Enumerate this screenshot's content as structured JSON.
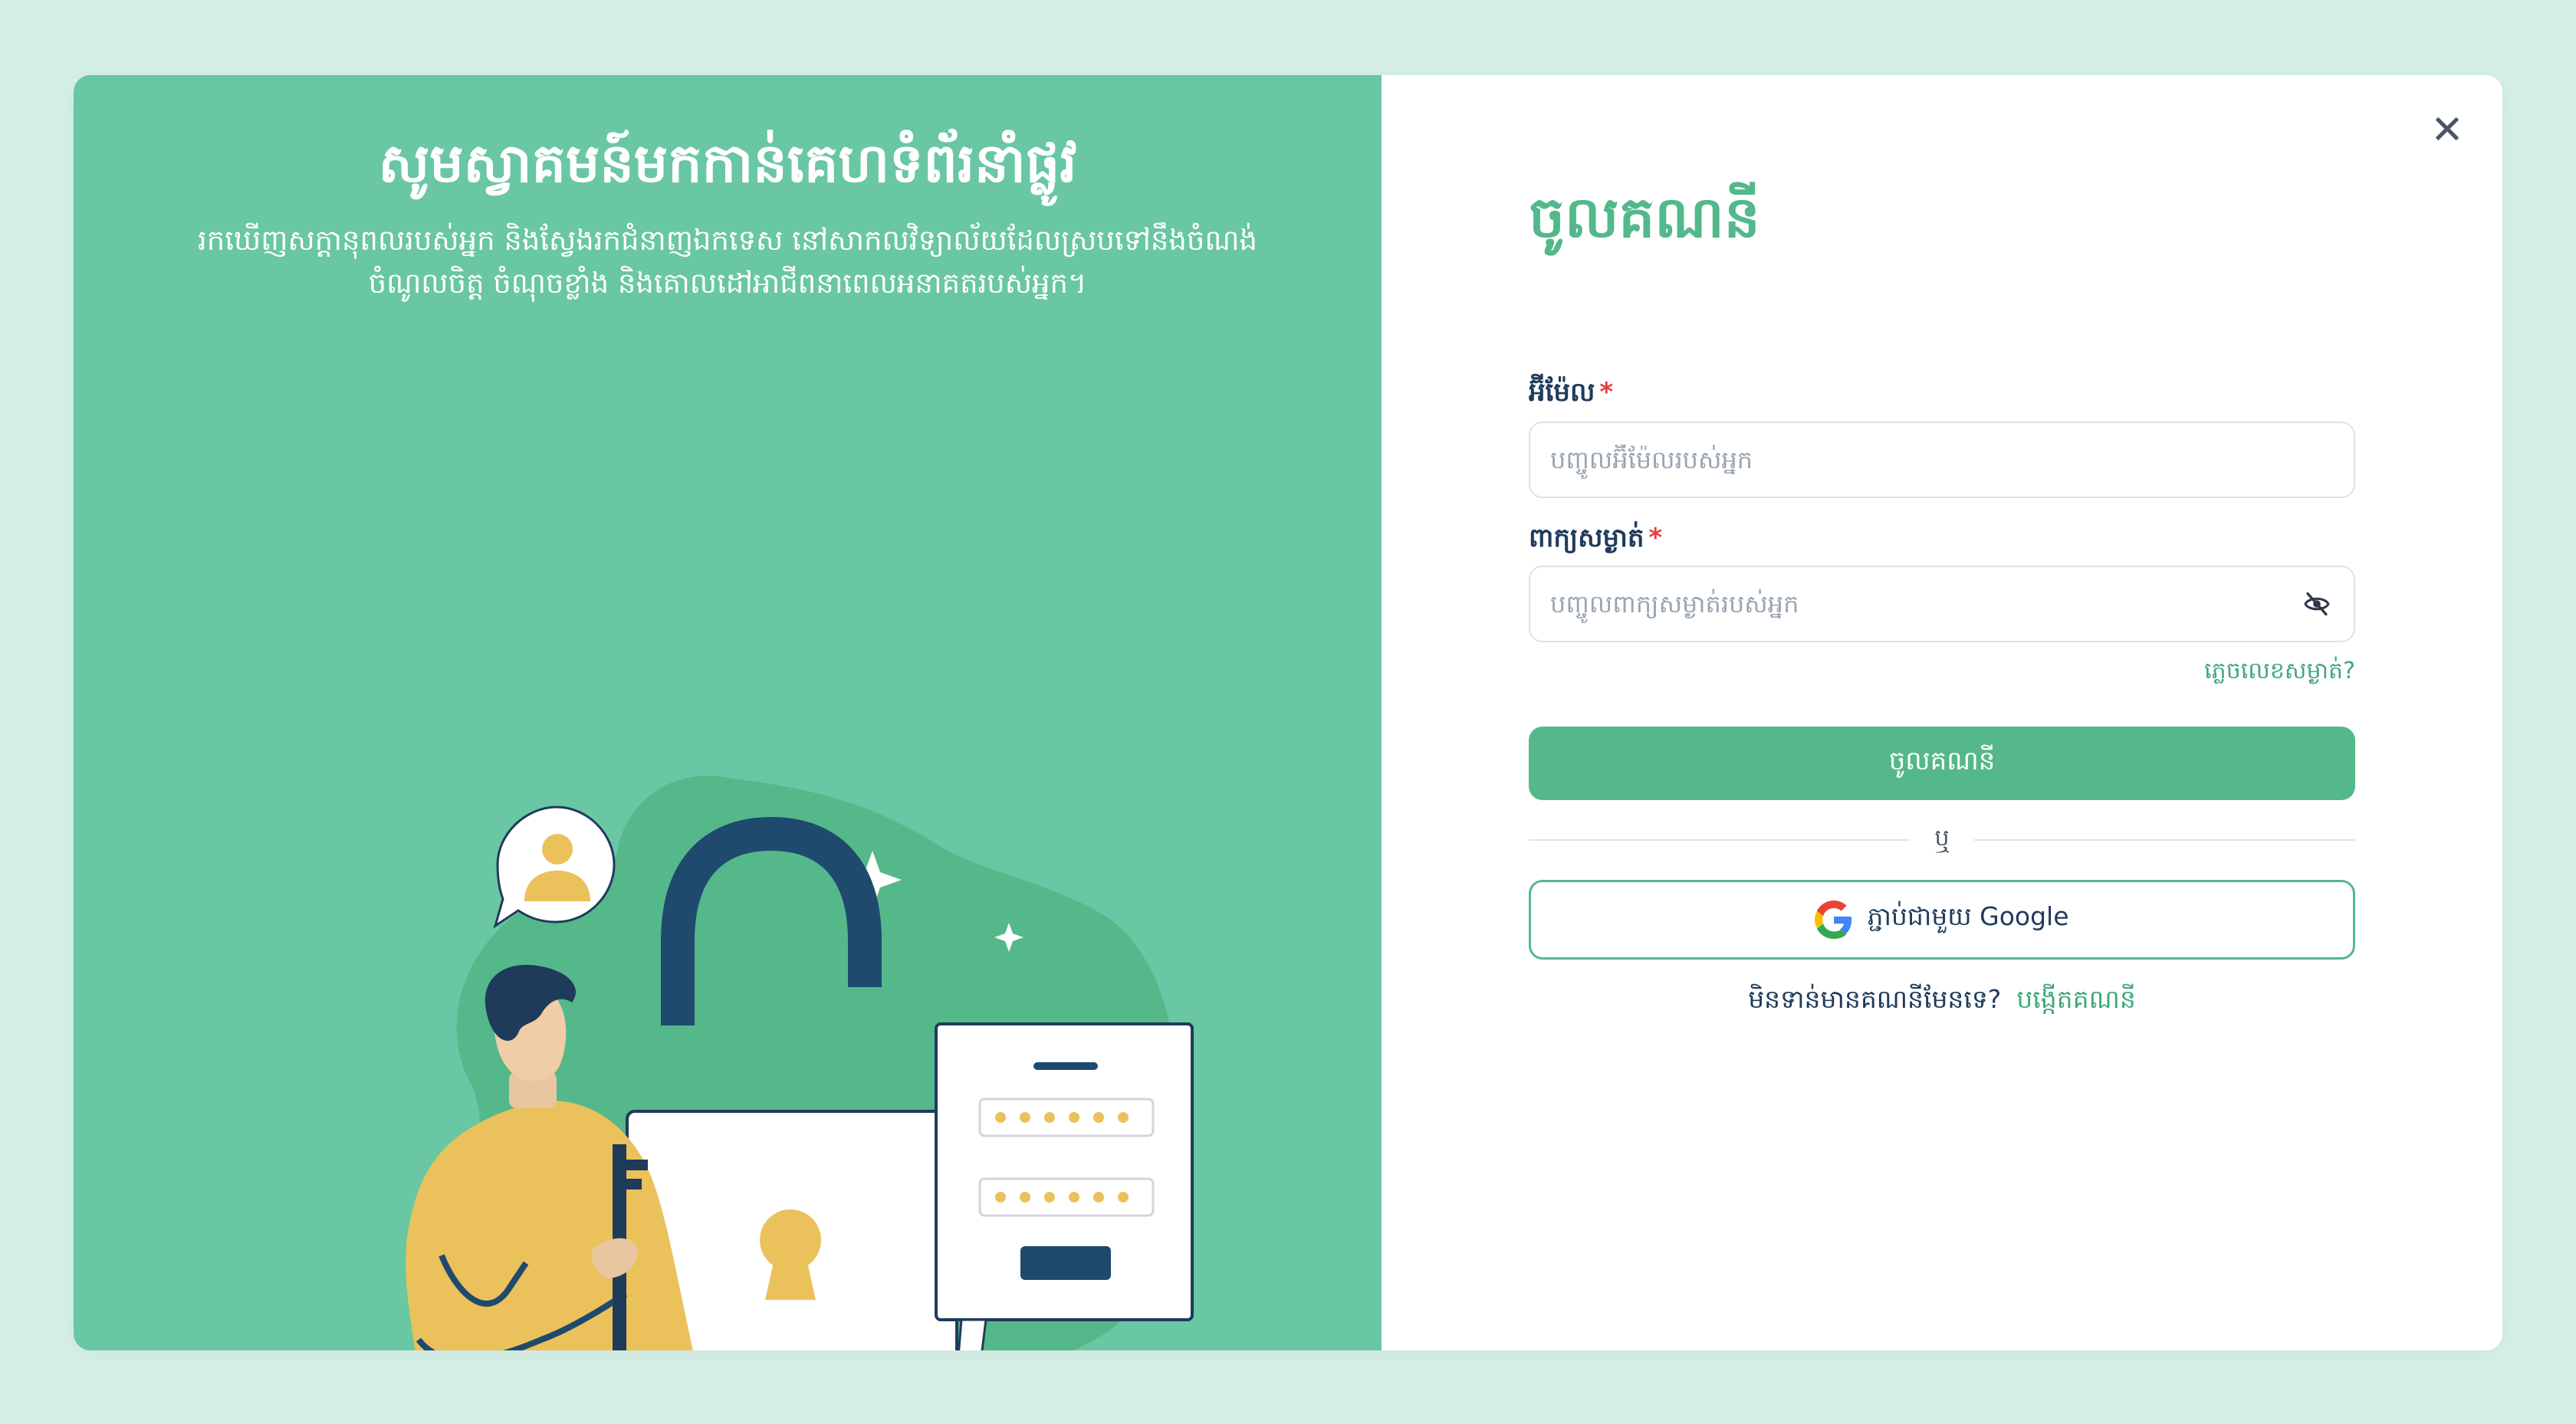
{
  "welcome": {
    "title": "សូមស្វាគមន៍មកកាន់គេហទំព័រនាំផ្លូវ",
    "subtitle": "រកឃើញសក្ដានុពលរបស់អ្នក និងស្វែងរកជំនាញឯកទេស នៅសាកលវិទ្យាល័យដែលស្របទៅនឹងចំណង់ចំណូលចិត្ត ចំណុចខ្លាំង និងគោលដៅអាជីពនាពេលអនាគតរបស់អ្នក។"
  },
  "login": {
    "title": "ចូលគណនី",
    "email_label": "អ៊ីម៉ែល",
    "email_placeholder": "បញ្ចូលអ៊ីម៉ែលរបស់អ្នក",
    "email_value": "",
    "password_label": "ពាក្យសម្ងាត់",
    "password_placeholder": "បញ្ចូលពាក្យសម្ងាត់របស់អ្នក",
    "password_value": "",
    "required_mark": "*",
    "forgot_label": "ភ្លេចលេខសម្ងាត់?",
    "submit_label": "ចូលគណនី",
    "divider_label": "ឬ",
    "google_label": "ភ្ជាប់ជាមួយ Google",
    "no_account_text": "មិនទាន់មានគណនីមែនទេ?",
    "signup_label": "បង្កើតគណនី"
  },
  "close_label": "✕",
  "icons": {
    "close": "close-icon",
    "eye_off": "eye-off-icon",
    "google": "google-icon"
  },
  "colors": {
    "page_background": "#d6f0e8",
    "panel_green": "#69c7a3",
    "accent_green": "#55b88b",
    "text_navy": "#1f3b5c",
    "required_red": "#e53e3e"
  }
}
